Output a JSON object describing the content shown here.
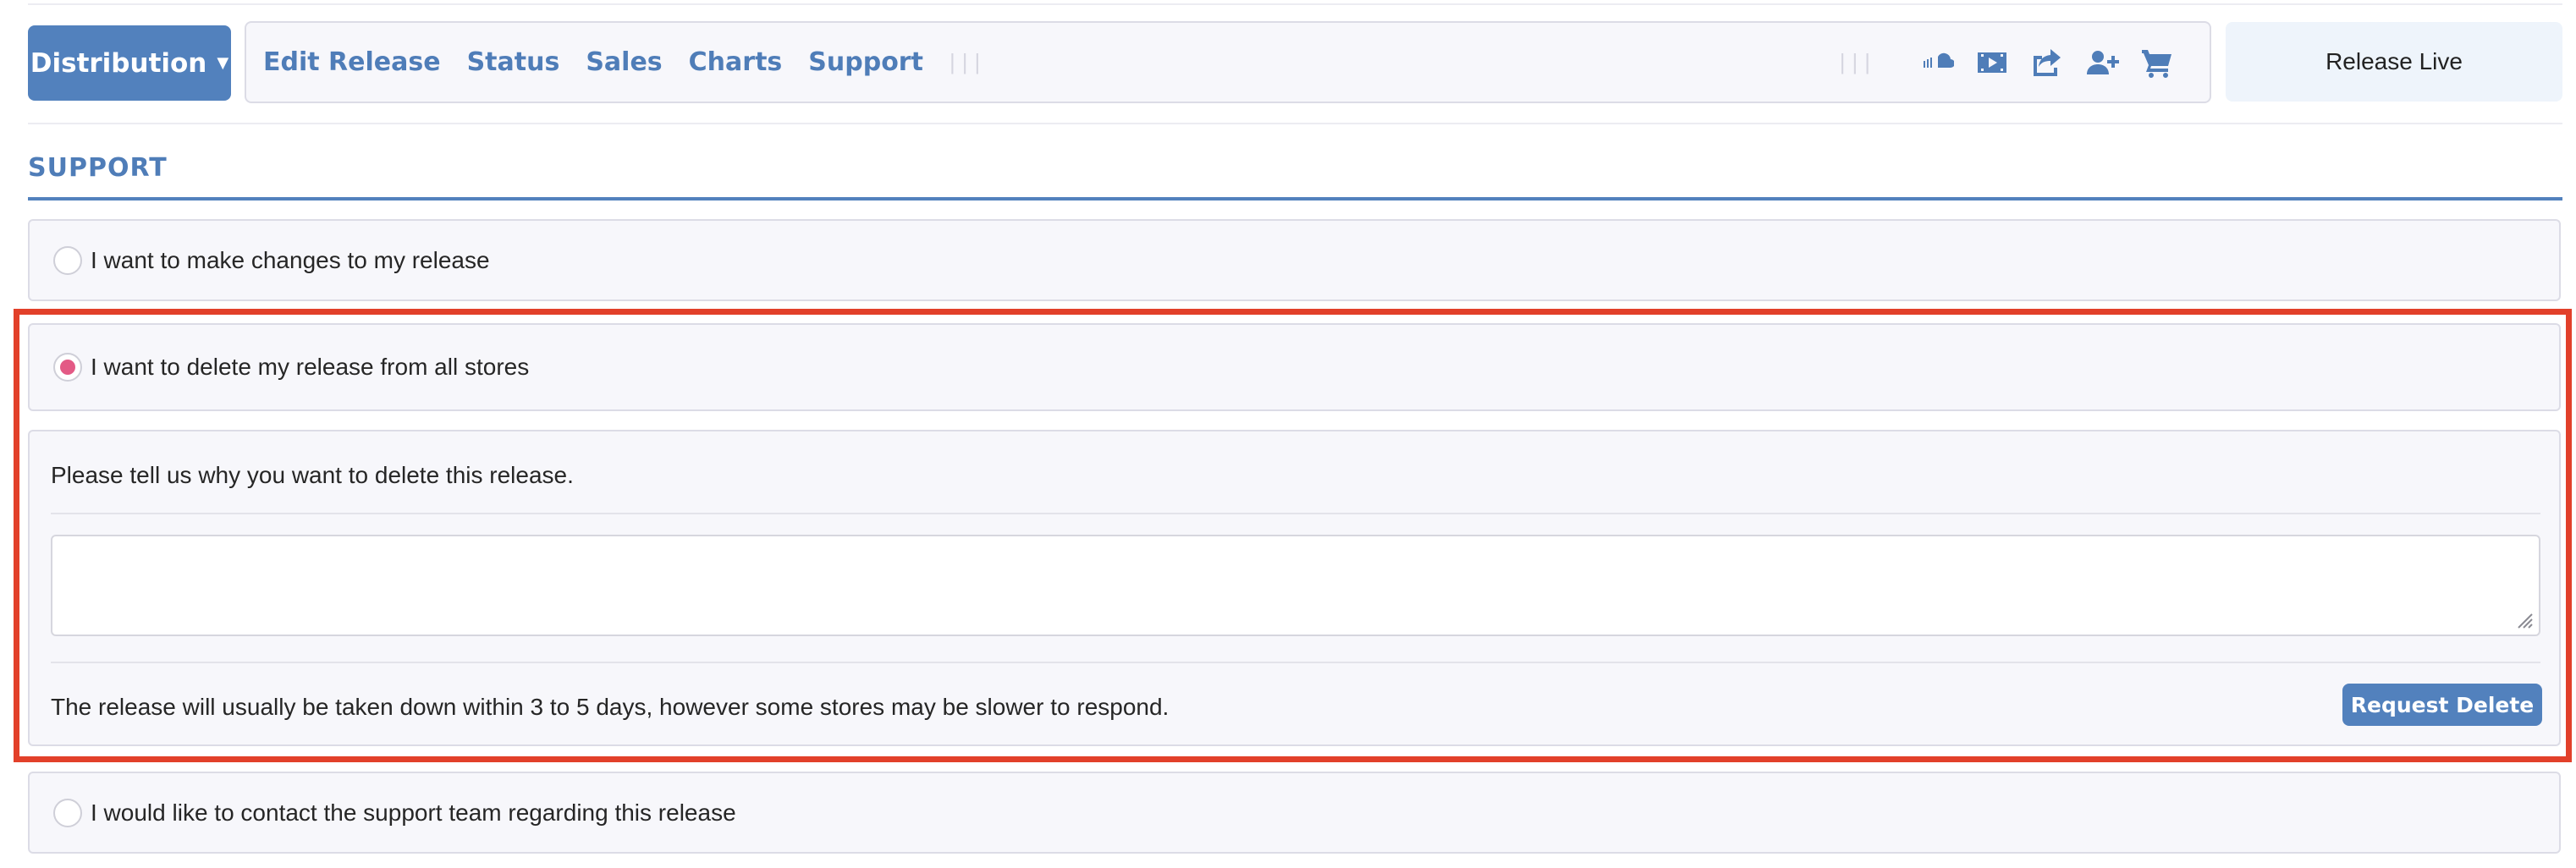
{
  "toolbar": {
    "distribution_label": "Distribution",
    "nav_links": [
      "Edit Release",
      "Status",
      "Sales",
      "Charts",
      "Support"
    ],
    "icons": [
      "soundcloud-icon",
      "video-icon",
      "share-icon",
      "add-user-icon",
      "cart-icon"
    ],
    "release_status": "Release Live"
  },
  "support": {
    "title": "SUPPORT",
    "options": {
      "changes": "I want to make changes to my release",
      "delete": "I want to delete my release from all stores",
      "contact": "I would like to contact the support team regarding this release"
    },
    "selected_option": "delete",
    "delete_panel": {
      "prompt": "Please tell us why you want to delete this release.",
      "reason_value": "",
      "note": "The release will usually be taken down within 3 to 5 days, however some stores may be slower to respond.",
      "button_label": "Request Delete"
    }
  },
  "colors": {
    "accent": "#5281bd",
    "radio_selected": "#e35a85",
    "highlight_border": "#e2402a",
    "panel_bg": "#f7f7fb"
  }
}
